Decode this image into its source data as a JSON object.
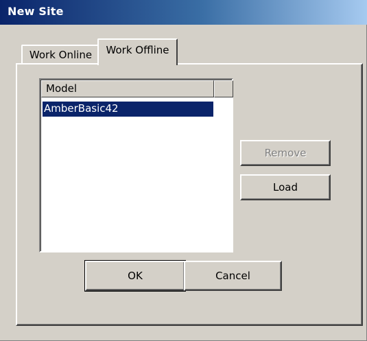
{
  "window": {
    "title": "New Site"
  },
  "tabs": [
    {
      "label": "Work Online",
      "active": false
    },
    {
      "label": "Work Offline",
      "active": true
    }
  ],
  "model_list": {
    "columns": [
      "Model",
      ""
    ],
    "rows": [
      {
        "model": "AmberBasic42",
        "selected": true
      }
    ]
  },
  "side_buttons": {
    "remove": {
      "label": "Remove",
      "enabled": false
    },
    "load": {
      "label": "Load",
      "enabled": true
    }
  },
  "footer_buttons": {
    "ok": {
      "label": "OK"
    },
    "cancel": {
      "label": "Cancel"
    }
  },
  "colors": {
    "title_bar_start": "#0a246a",
    "title_bar_end": "#a6caf0",
    "dialog_face": "#d4d0c8",
    "selection": "#0a246a",
    "disabled_text": "#808080"
  }
}
